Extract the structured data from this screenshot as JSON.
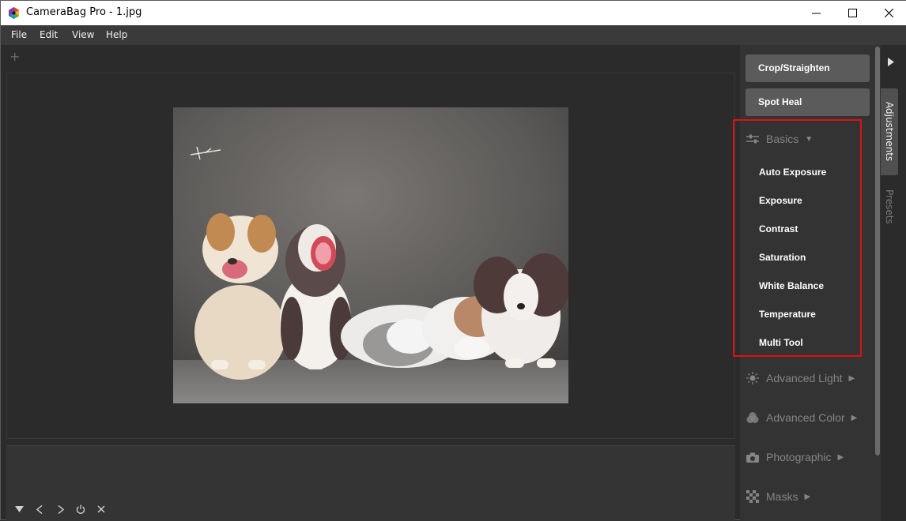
{
  "window": {
    "title": "CameraBag Pro - 1.jpg"
  },
  "menu": {
    "items": [
      "File",
      "Edit",
      "View",
      "Help"
    ]
  },
  "tabs": {
    "add_label": "+"
  },
  "tools": {
    "crop": "Crop/Straighten",
    "spot_heal": "Spot Heal"
  },
  "sections": {
    "basics": {
      "label": "Basics",
      "items": [
        "Auto Exposure",
        "Exposure",
        "Contrast",
        "Saturation",
        "White Balance",
        "Temperature",
        "Multi Tool"
      ]
    },
    "advanced_light": {
      "label": "Advanced Light"
    },
    "advanced_color": {
      "label": "Advanced Color"
    },
    "photographic": {
      "label": "Photographic"
    },
    "masks": {
      "label": "Masks"
    }
  },
  "side_tabs": {
    "adjustments": "Adjustments",
    "presets": "Presets"
  },
  "colors": {
    "highlight": "#e01010",
    "panel": "#333333",
    "button": "#5b5b5b"
  }
}
